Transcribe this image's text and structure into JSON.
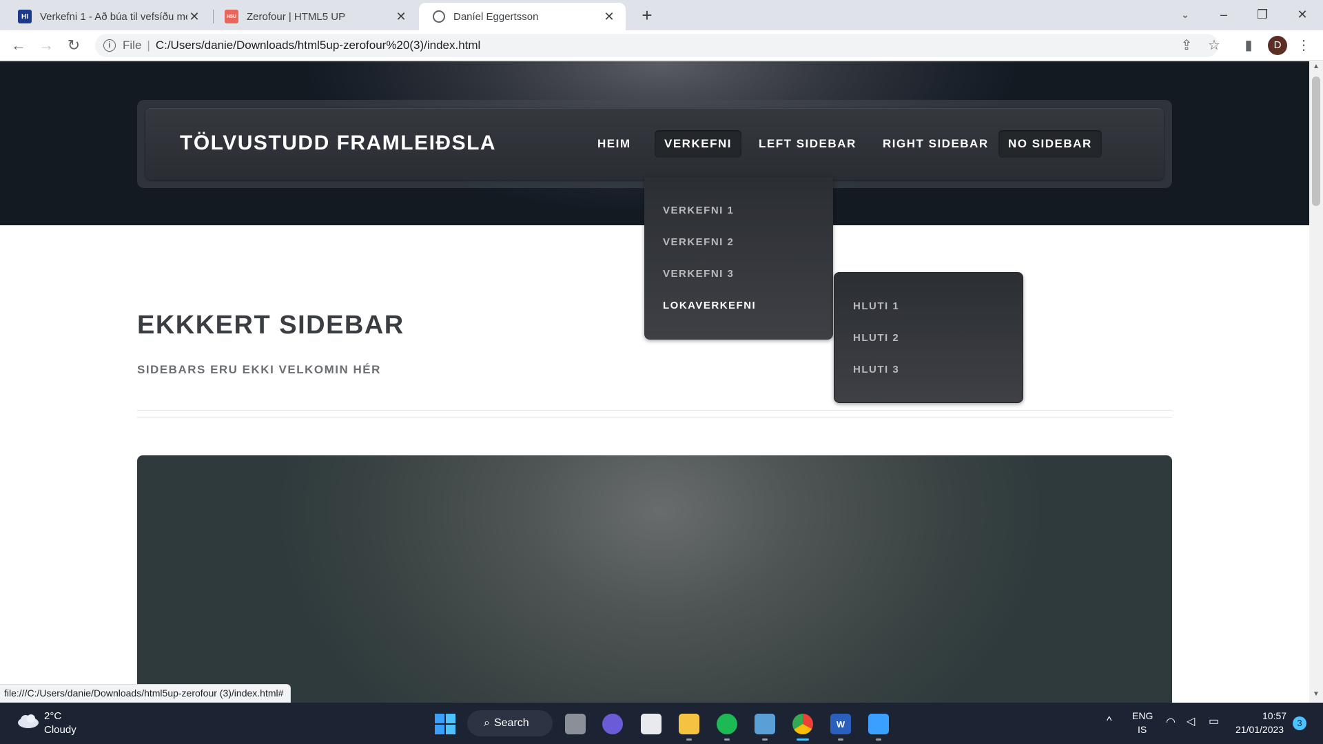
{
  "browser": {
    "tabs": [
      {
        "title": "Verkefni 1 - Að búa til vefsíðu me",
        "favicon_label": "HI",
        "favicon_color": "#1b3a8c"
      },
      {
        "title": "Zerofour | HTML5 UP",
        "favicon_label": "H5U",
        "favicon_color": "#e8665a"
      },
      {
        "title": "Daníel Eggertsson",
        "favicon_label": "globe-icon",
        "favicon_color": "#5f6368"
      }
    ],
    "address": {
      "scheme_label": "File",
      "url": "C:/Users/danie/Downloads/html5up-zerofour%20(3)/index.html"
    },
    "profile_initial": "D",
    "status_url": "file:///C:/Users/danie/Downloads/html5up-zerofour (3)/index.html#"
  },
  "site": {
    "logo": "TÖLVUSTUDD FRAMLEIÐSLA",
    "nav": [
      "HEIM",
      "VERKEFNI",
      "LEFT SIDEBAR",
      "RIGHT SIDEBAR",
      "NO SIDEBAR"
    ],
    "dropdown": [
      "VERKEFNI 1",
      "VERKEFNI 2",
      "VERKEFNI 3",
      "LOKAVERKEFNI"
    ],
    "submenu": [
      "HLUTI 1",
      "HLUTI 2",
      "HLUTI 3"
    ],
    "heading": "EKKKERT SIDEBAR",
    "subheading": "SIDEBARS ERU EKKI VELKOMIN HÉR"
  },
  "taskbar": {
    "weather_temp": "2°C",
    "weather_desc": "Cloudy",
    "search_label": "Search",
    "lang_top": "ENG",
    "lang_bottom": "IS",
    "time": "10:57",
    "date": "21/01/2023",
    "notifications": "3"
  },
  "colors": {
    "hero_dark": "#141a22",
    "nav_bg": "#2a2d33",
    "accent_blue": "#4cc2ff"
  }
}
